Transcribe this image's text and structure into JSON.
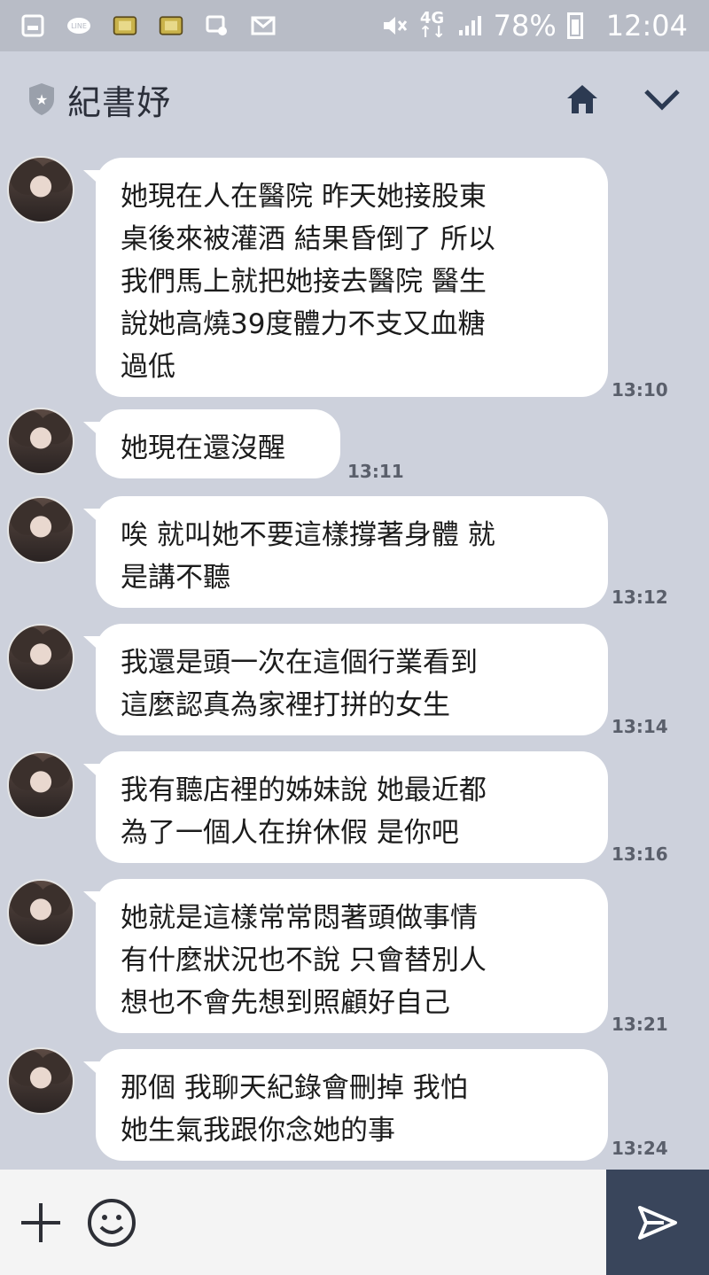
{
  "status": {
    "battery": "78%",
    "time": "12:04",
    "network_top": "4G",
    "network_bottom": "↑↓"
  },
  "header": {
    "title": "紀書妤"
  },
  "messages": [
    {
      "text": "她現在人在醫院 昨天她接股東\n桌後來被灌酒 結果昏倒了 所以\n我們馬上就把她接去醫院 醫生\n說她高燒39度體力不支又血糖\n過低",
      "time": "13:10"
    },
    {
      "text": "她現在還沒醒",
      "time": "13:11"
    },
    {
      "text": "唉 就叫她不要這樣撐著身體 就\n是講不聽",
      "time": "13:12"
    },
    {
      "text": "我還是頭一次在這個行業看到\n這麼認真為家裡打拼的女生",
      "time": "13:14"
    },
    {
      "text": "我有聽店裡的姊妹說 她最近都\n為了一個人在拚休假  是你吧",
      "time": "13:16"
    },
    {
      "text": "她就是這樣常常悶著頭做事情\n有什麼狀況也不說 只會替別人\n想也不會先想到照顧好自己",
      "time": "13:21"
    },
    {
      "text": "那個 我聊天紀錄會刪掉  我怕\n她生氣我跟你念她的事",
      "time": "13:24"
    }
  ],
  "colors": {
    "background": "#cdd1dc",
    "bubble": "#ffffff",
    "send": "#39455b"
  },
  "icons": {
    "status": [
      "gallery-icon",
      "line-icon",
      "notification-icon",
      "notification-icon",
      "screenshot-icon",
      "mail-icon",
      "mute-icon",
      "signal-icon",
      "battery-icon"
    ],
    "header": [
      "shield-icon",
      "home-icon",
      "chevron-down-icon"
    ],
    "input": [
      "plus-icon",
      "smile-icon",
      "send-icon"
    ]
  }
}
